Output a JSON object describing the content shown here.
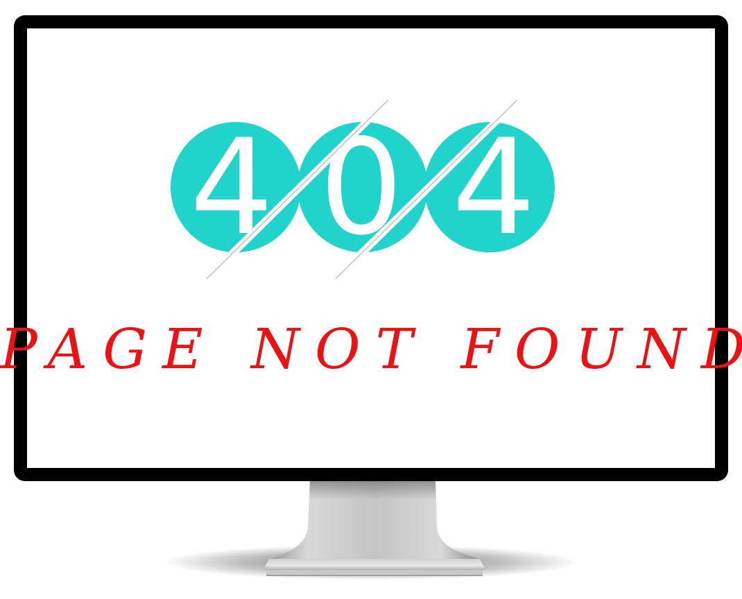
{
  "error": {
    "code_digits": [
      "4",
      "0",
      "4"
    ],
    "message": "PAGE NOT FOUND"
  },
  "colors": {
    "circle": "#20d3cb",
    "digit": "#ffffff",
    "message": "#ee1111",
    "bezel": "#000000",
    "screen": "#ffffff"
  },
  "icons": {
    "device": "monitor-icon"
  }
}
